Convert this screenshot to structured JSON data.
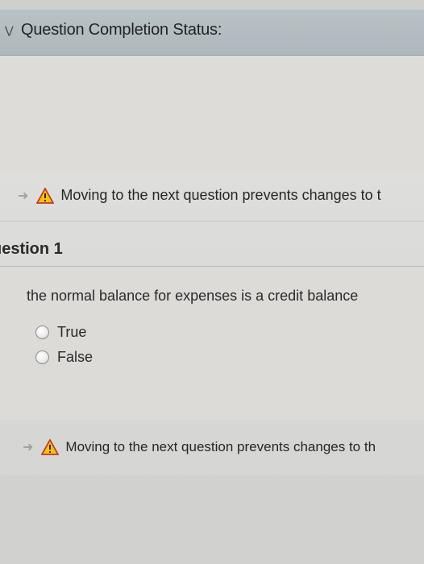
{
  "status_bar": {
    "title": "Question Completion Status:",
    "toggle_icon": "chevron-down-icon"
  },
  "warnings": [
    {
      "text": "Moving to the next question prevents changes to t",
      "icon": "warning-icon"
    },
    {
      "text": "Moving to the next question prevents changes to th",
      "icon": "warning-icon"
    }
  ],
  "question": {
    "label": "uestion 1",
    "text": "the normal balance for expenses is a credit balance",
    "options": [
      {
        "label": "True",
        "selected": false
      },
      {
        "label": "False",
        "selected": false
      }
    ]
  },
  "colors": {
    "status_bar_bg": "#b9c2c6",
    "warning_yellow": "#f1c40f",
    "warning_red": "#c0392b"
  }
}
